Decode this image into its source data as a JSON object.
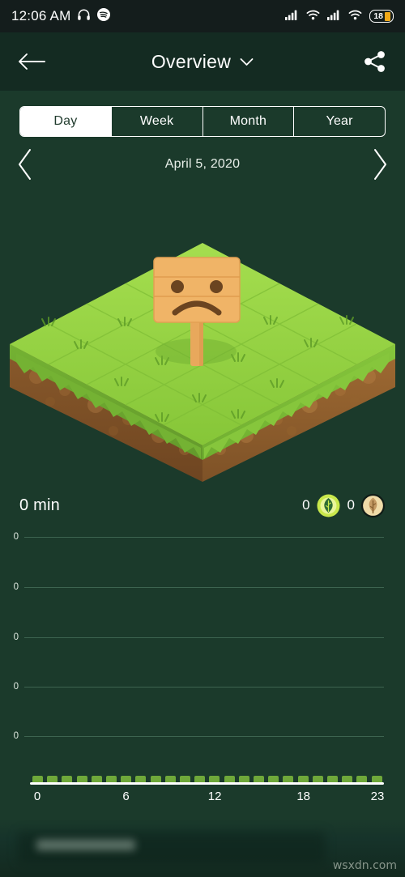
{
  "status_bar": {
    "time": "12:06 AM",
    "left_icons": [
      "headphones-icon",
      "spotify-icon"
    ],
    "right_icons": [
      "signal-bars-icon",
      "wifi-icon",
      "signal-bars-icon",
      "wifi-icon"
    ],
    "battery_level": "18"
  },
  "header": {
    "back_label": "back-arrow",
    "title": "Overview",
    "dropdown_icon": "chevron-down-icon",
    "share_icon": "share-icon"
  },
  "tabs": {
    "items": [
      {
        "label": "Day",
        "active": true
      },
      {
        "label": "Week",
        "active": false
      },
      {
        "label": "Month",
        "active": false
      },
      {
        "label": "Year",
        "active": false
      }
    ]
  },
  "date_nav": {
    "prev_icon": "chevron-left-icon",
    "date": "April 5, 2020",
    "next_icon": "chevron-right-icon"
  },
  "illustration": {
    "name": "empty-plot-sad-sign",
    "sign_face": "sad-face",
    "grass_color": "#8CCB3D",
    "soil_color": "#8A5A2B"
  },
  "summary": {
    "total_time": "0 min",
    "stats": [
      {
        "value": "0",
        "icon": "leaf-badge-icon"
      },
      {
        "value": "0",
        "icon": "tree-coin-badge-icon"
      }
    ]
  },
  "chart_data": {
    "type": "bar",
    "title": "",
    "xlabel": "",
    "ylabel": "",
    "categories": [
      "0",
      "1",
      "2",
      "3",
      "4",
      "5",
      "6",
      "7",
      "8",
      "9",
      "10",
      "11",
      "12",
      "13",
      "14",
      "15",
      "16",
      "17",
      "18",
      "19",
      "20",
      "21",
      "22",
      "23"
    ],
    "values": [
      0,
      0,
      0,
      0,
      0,
      0,
      0,
      0,
      0,
      0,
      0,
      0,
      0,
      0,
      0,
      0,
      0,
      0,
      0,
      0,
      0,
      0,
      0,
      0
    ],
    "xtick_labels": [
      "0",
      "6",
      "12",
      "18",
      "23"
    ],
    "xtick_positions": [
      0,
      6,
      12,
      18,
      23
    ],
    "ytick_labels": [
      "0",
      "0",
      "0",
      "0",
      "0"
    ],
    "ylim": [
      0,
      0
    ],
    "grid": true,
    "legend": "none",
    "bar_color": "#6FA83A",
    "axis_color": "#FFFFFF",
    "grid_color": "#3D6450"
  },
  "footer": {
    "watermark": "wsxdn.com"
  },
  "theme": {
    "background": "#1B3A2B",
    "header_background": "#142B22",
    "statusbar_background": "#141D1C",
    "accent": "#8CCB3D",
    "text": "#FFFFFF",
    "battery_accent": "#F0A818"
  }
}
